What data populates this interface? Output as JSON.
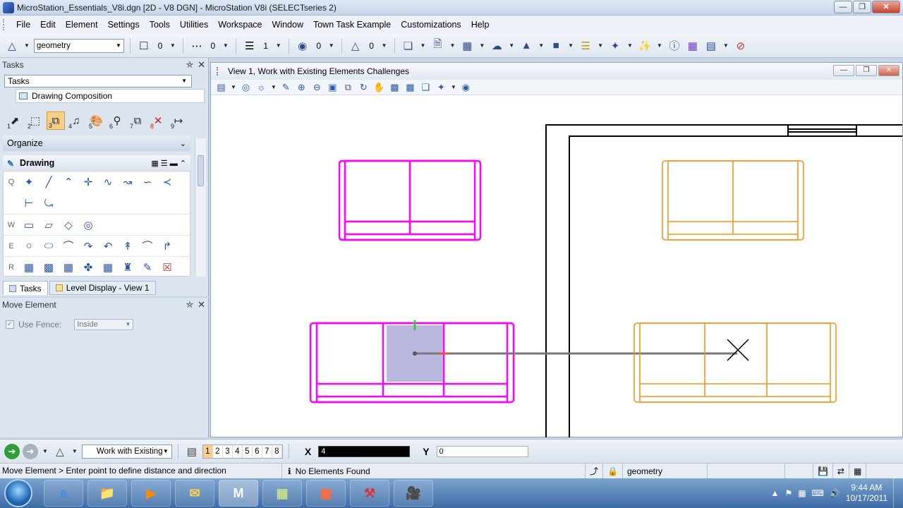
{
  "window": {
    "title": "MicroStation_Essentials_V8i.dgn [2D - V8 DGN] - MicroStation V8i (SELECTseries 2)",
    "controls": [
      "minimize",
      "restore",
      "close"
    ]
  },
  "menu": [
    "File",
    "Edit",
    "Element",
    "Settings",
    "Tools",
    "Utilities",
    "Workspace",
    "Window",
    "Town Task Example",
    "Customizations",
    "Help"
  ],
  "attributes": {
    "level": "geometry",
    "color": "0",
    "style": "0",
    "weight": "1",
    "transparency": "0",
    "priority": "0"
  },
  "tasks_panel": {
    "title": "Tasks",
    "combo_value": "Tasks",
    "drawing_composition": "Drawing Composition",
    "tool_numbers": [
      "1",
      "2",
      "3",
      "4",
      "5",
      "6",
      "7",
      "8",
      "9"
    ],
    "organize_label": "Organize",
    "drawing_label": "Drawing",
    "row_keys": [
      "Q",
      "",
      "W",
      "E",
      "R"
    ],
    "tabs": [
      "Tasks",
      "Level Display - View 1"
    ]
  },
  "move_panel": {
    "title": "Move Element",
    "use_fence_label": "Use Fence:",
    "fence_mode": "Inside"
  },
  "view": {
    "title": "View 1, Work with Existing Elements Challenges"
  },
  "canvas_colors": {
    "selected": "#ff00ff",
    "furniture": "#f0961e",
    "dynamic": "#b3b0dc",
    "border": "#000000"
  },
  "command_bar": {
    "task": "Work with Existing",
    "view_numbers": [
      "1",
      "2",
      "3",
      "4",
      "5",
      "6",
      "7",
      "8"
    ],
    "x_label": "X",
    "x_value": "4",
    "y_label": "Y",
    "y_value": "0"
  },
  "status": {
    "prompt": "Move Element > Enter point to define distance and direction",
    "message": "No Elements Found",
    "active_level": "geometry"
  },
  "taskbar": {
    "time": "9:44 AM",
    "date": "10/17/2011"
  }
}
